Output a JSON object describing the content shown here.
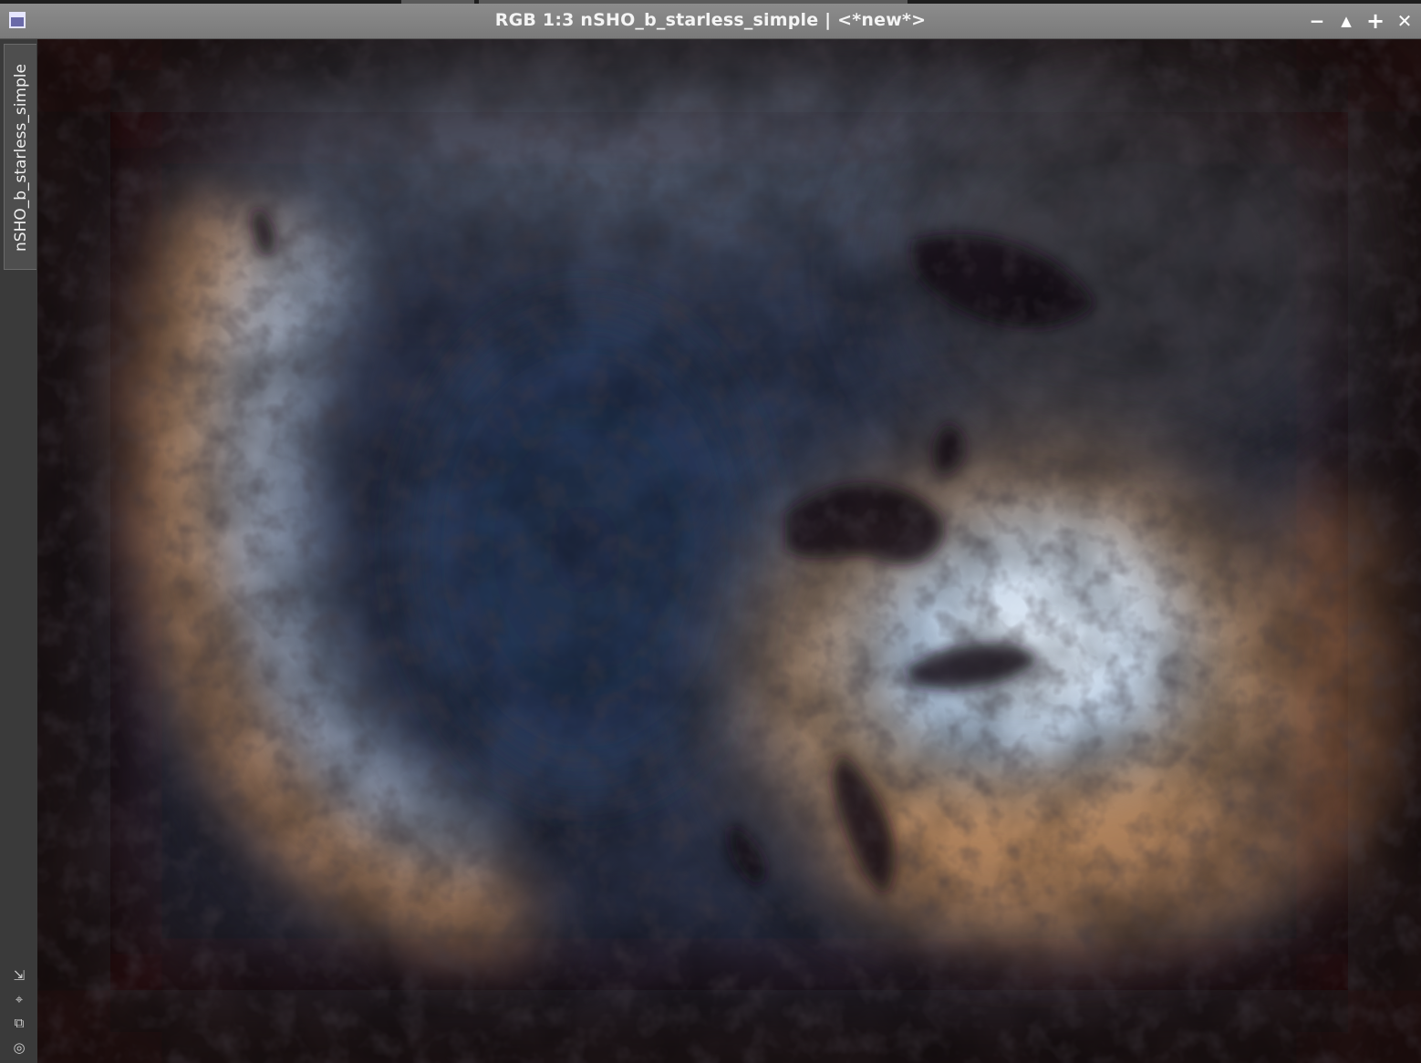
{
  "window": {
    "title": "RGB 1:3 nSHO_b_starless_simple | <*new*>",
    "icon": "image-window-icon",
    "controls": [
      {
        "name": "minimize-button",
        "icon": "minimize-icon",
        "glyph": "−"
      },
      {
        "name": "shade-button",
        "icon": "shade-icon",
        "glyph": "▲"
      },
      {
        "name": "maximize-button",
        "icon": "maximize-icon",
        "glyph": "+"
      },
      {
        "name": "close-button",
        "icon": "close-icon",
        "glyph": "✕"
      }
    ]
  },
  "sidebar": {
    "tab_label": "nSHO_b_starless_simple",
    "tools": [
      {
        "name": "resize-tool-icon",
        "glyph": "⇲"
      },
      {
        "name": "fit-view-icon",
        "glyph": "⌖"
      },
      {
        "name": "clone-view-icon",
        "glyph": "⧉"
      },
      {
        "name": "target-icon",
        "glyph": "◎"
      }
    ]
  },
  "image": {
    "description_colors": {
      "background": "#1d2436",
      "blue_core": "#c9d9ec",
      "gold_rim": "#c98a55",
      "dark_lanes": "#140f10"
    }
  }
}
